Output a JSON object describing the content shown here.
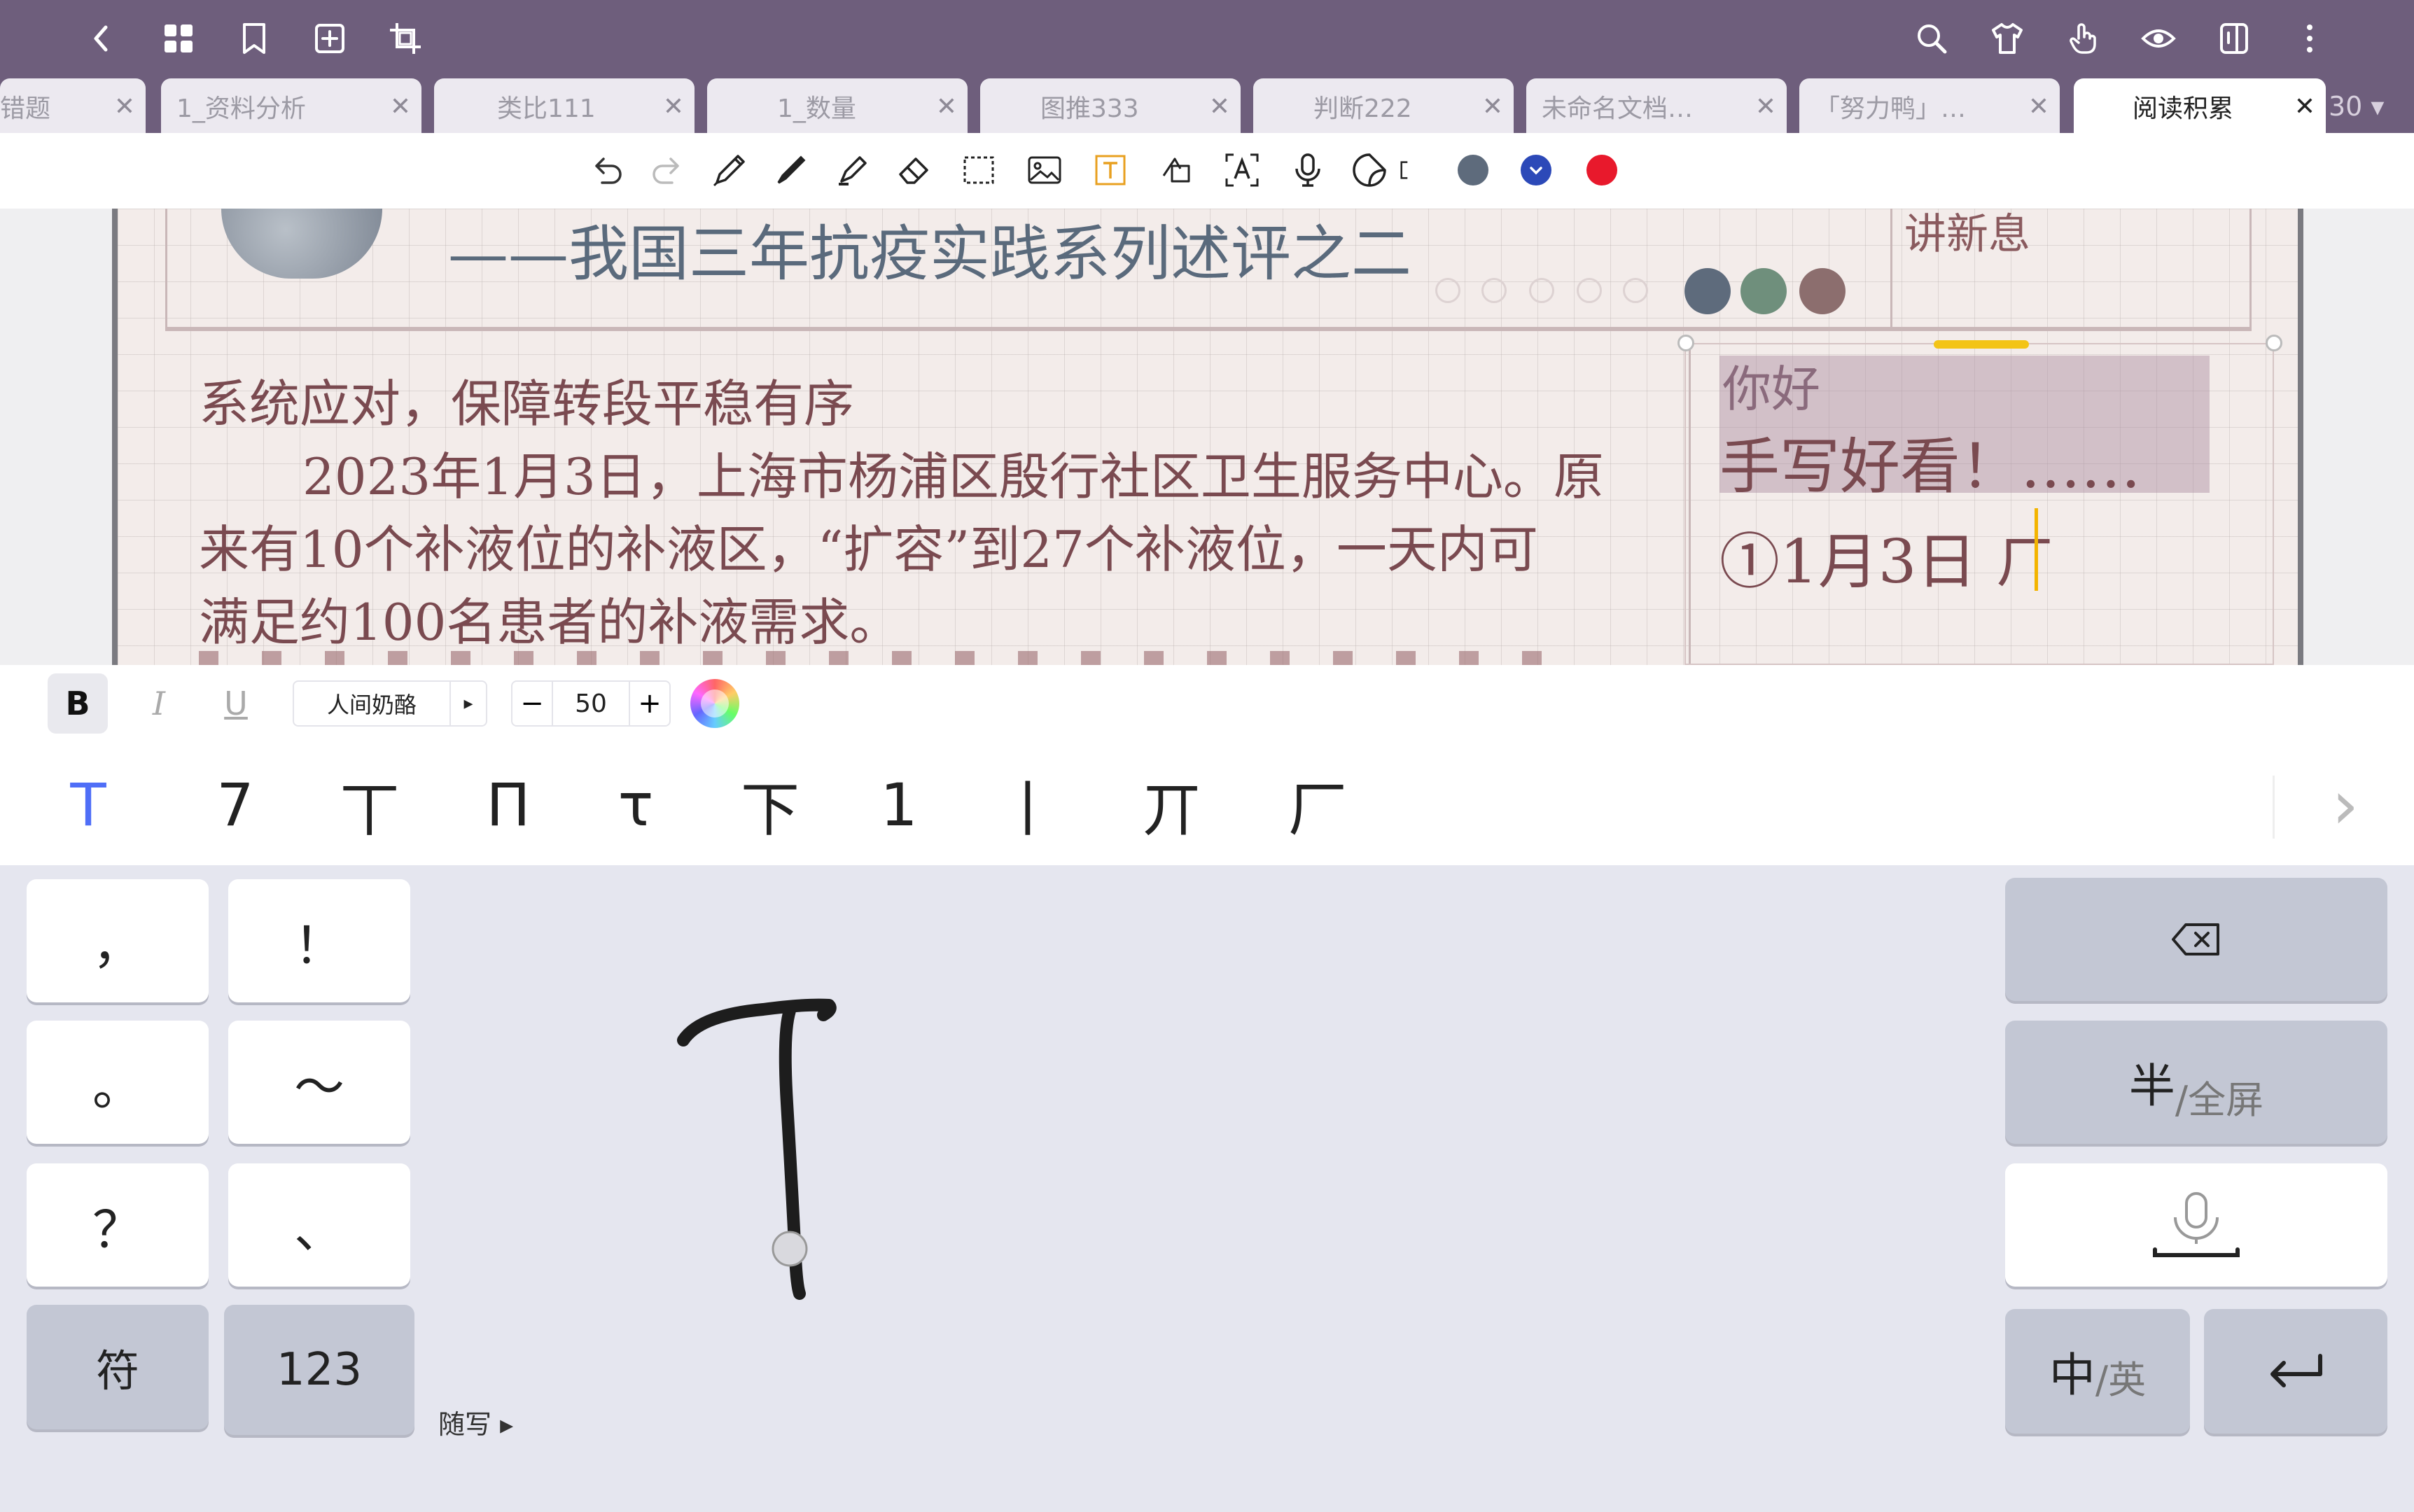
{
  "colors": {
    "topbar": "#6e5e7c",
    "accent_blue": "#4f6ef7",
    "pen_dark": "#5e6b7c",
    "pen_blue": "#2c49b8",
    "pen_red": "#e8192c",
    "swatch_1": "#5e6b7c",
    "swatch_2": "#6f8f7c",
    "swatch_3": "#8c6e6e"
  },
  "top_icons": [
    "back-icon",
    "grid-icon",
    "bookmark-icon",
    "add-page-icon",
    "crop-icon",
    "search-icon",
    "shirt-icon",
    "hand-touch-icon",
    "eye-icon",
    "sidebar-icon",
    "more-icon"
  ],
  "tabs": [
    {
      "label": "错题"
    },
    {
      "label": "1_资料分析"
    },
    {
      "label": "类比111"
    },
    {
      "label": "1_数量"
    },
    {
      "label": "图推333"
    },
    {
      "label": "判断222"
    },
    {
      "label": "未命名文档…"
    },
    {
      "label": "「努力鸭」…"
    },
    {
      "label": "阅读积累"
    }
  ],
  "tab_close": "✕",
  "tab_count": "30 ▾",
  "document": {
    "title": "——我国三年抗疫实践系列述评之二",
    "side_header": "讲新息",
    "heading": "系统应对，保障转段平稳有序",
    "para_line1": "2023年1月3日，上海市杨浦区殷行社区卫生服务中心。原",
    "para_line2": "来有10个补液位的补液区，“扩容”到27个补液位，一天内可",
    "para_line3": "满足约100名患者的补液需求。",
    "note_line0": "你好",
    "note_line1": "手写好看！……",
    "note_line2": "①1月3日 ㄏ"
  },
  "format_bar": {
    "bold": "B",
    "italic": "I",
    "underline": "U",
    "font_name": "人间奶酪",
    "font_arrow": "▸",
    "minus": "−",
    "size": "50",
    "plus": "+"
  },
  "candidates": [
    "T",
    "7",
    "丅",
    "Π",
    "τ",
    "下",
    "1",
    "丨",
    "丌",
    "厂"
  ],
  "candidates_next": "›",
  "keyboard": {
    "comma": "，",
    "exclaim": "！",
    "period": "。",
    "tilde": "～",
    "question": "？",
    "dun": "、",
    "symbols": "符",
    "numbers": "123",
    "free_write": "随写 ▸",
    "half_full_main": "半",
    "half_full_sub": "/全屏",
    "lang_main": "中",
    "lang_sub": "/英"
  }
}
